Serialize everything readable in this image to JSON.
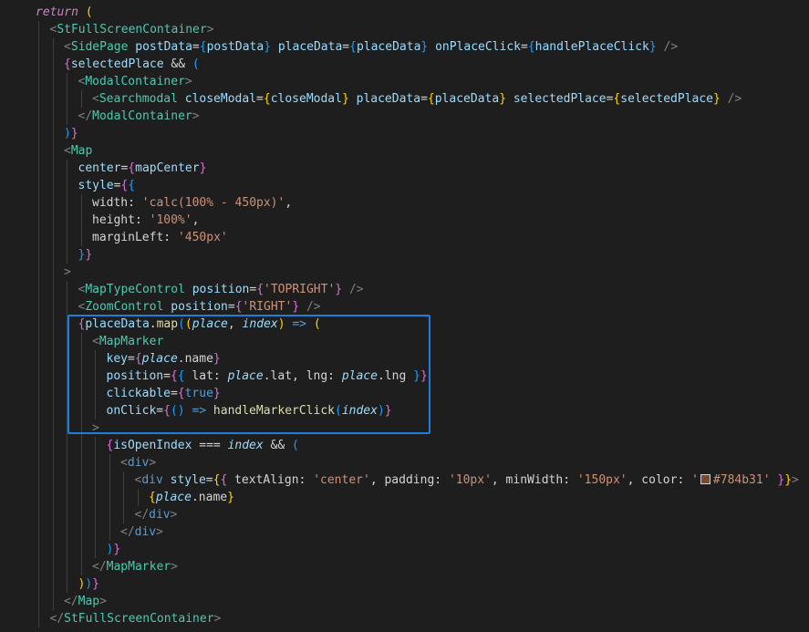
{
  "editor": {
    "swatch_color": "#784b31",
    "lines": [
      {
        "indent": 2,
        "tokens": [
          {
            "t": "return",
            "c": "kw"
          },
          {
            "t": " ",
            "c": "pl"
          },
          {
            "t": "(",
            "c": "b1"
          }
        ]
      },
      {
        "indent": 3,
        "tokens": [
          {
            "t": "<",
            "c": "pu"
          },
          {
            "t": "StFullScreenContainer",
            "c": "tg"
          },
          {
            "t": ">",
            "c": "pu"
          }
        ]
      },
      {
        "indent": 4,
        "tokens": [
          {
            "t": "<",
            "c": "pu"
          },
          {
            "t": "SidePage",
            "c": "tg"
          },
          {
            "t": " ",
            "c": "pl"
          },
          {
            "t": "postData",
            "c": "at"
          },
          {
            "t": "=",
            "c": "op"
          },
          {
            "t": "{",
            "c": "b3"
          },
          {
            "t": "postData",
            "c": "vr"
          },
          {
            "t": "}",
            "c": "b3"
          },
          {
            "t": " ",
            "c": "pl"
          },
          {
            "t": "placeData",
            "c": "at"
          },
          {
            "t": "=",
            "c": "op"
          },
          {
            "t": "{",
            "c": "b3"
          },
          {
            "t": "placeData",
            "c": "vr"
          },
          {
            "t": "}",
            "c": "b3"
          },
          {
            "t": " ",
            "c": "pl"
          },
          {
            "t": "onPlaceClick",
            "c": "at"
          },
          {
            "t": "=",
            "c": "op"
          },
          {
            "t": "{",
            "c": "b3"
          },
          {
            "t": "handlePlaceClick",
            "c": "vr"
          },
          {
            "t": "}",
            "c": "b3"
          },
          {
            "t": " />",
            "c": "pu"
          }
        ]
      },
      {
        "indent": 4,
        "tokens": [
          {
            "t": "{",
            "c": "b2"
          },
          {
            "t": "selectedPlace",
            "c": "vr"
          },
          {
            "t": " && ",
            "c": "op"
          },
          {
            "t": "(",
            "c": "b3"
          }
        ]
      },
      {
        "indent": 5,
        "tokens": [
          {
            "t": "<",
            "c": "pu"
          },
          {
            "t": "ModalContainer",
            "c": "tg"
          },
          {
            "t": ">",
            "c": "pu"
          }
        ]
      },
      {
        "indent": 6,
        "tokens": [
          {
            "t": "<",
            "c": "pu"
          },
          {
            "t": "Searchmodal",
            "c": "tg"
          },
          {
            "t": " ",
            "c": "pl"
          },
          {
            "t": "closeModal",
            "c": "at"
          },
          {
            "t": "=",
            "c": "op"
          },
          {
            "t": "{",
            "c": "b1"
          },
          {
            "t": "closeModal",
            "c": "vr"
          },
          {
            "t": "}",
            "c": "b1"
          },
          {
            "t": " ",
            "c": "pl"
          },
          {
            "t": "placeData",
            "c": "at"
          },
          {
            "t": "=",
            "c": "op"
          },
          {
            "t": "{",
            "c": "b1"
          },
          {
            "t": "placeData",
            "c": "vr"
          },
          {
            "t": "}",
            "c": "b1"
          },
          {
            "t": " ",
            "c": "pl"
          },
          {
            "t": "selectedPlace",
            "c": "at"
          },
          {
            "t": "=",
            "c": "op"
          },
          {
            "t": "{",
            "c": "b1"
          },
          {
            "t": "selectedPlace",
            "c": "vr"
          },
          {
            "t": "}",
            "c": "b1"
          },
          {
            "t": " />",
            "c": "pu"
          }
        ]
      },
      {
        "indent": 5,
        "tokens": [
          {
            "t": "</",
            "c": "pu"
          },
          {
            "t": "ModalContainer",
            "c": "tg"
          },
          {
            "t": ">",
            "c": "pu"
          }
        ]
      },
      {
        "indent": 4,
        "tokens": [
          {
            "t": ")",
            "c": "b3"
          },
          {
            "t": "}",
            "c": "b2"
          }
        ]
      },
      {
        "indent": 4,
        "tokens": [
          {
            "t": "<",
            "c": "pu"
          },
          {
            "t": "Map",
            "c": "tg"
          }
        ]
      },
      {
        "indent": 5,
        "tokens": [
          {
            "t": "center",
            "c": "at"
          },
          {
            "t": "=",
            "c": "op"
          },
          {
            "t": "{",
            "c": "b2"
          },
          {
            "t": "mapCenter",
            "c": "vr"
          },
          {
            "t": "}",
            "c": "b2"
          }
        ]
      },
      {
        "indent": 5,
        "tokens": [
          {
            "t": "style",
            "c": "at"
          },
          {
            "t": "=",
            "c": "op"
          },
          {
            "t": "{",
            "c": "b2"
          },
          {
            "t": "{",
            "c": "b3"
          }
        ]
      },
      {
        "indent": 6,
        "tokens": [
          {
            "t": "width",
            "c": "pl"
          },
          {
            "t": ": ",
            "c": "op"
          },
          {
            "t": "'calc(100% - 450px)'",
            "c": "st"
          },
          {
            "t": ",",
            "c": "op"
          }
        ]
      },
      {
        "indent": 6,
        "tokens": [
          {
            "t": "height",
            "c": "pl"
          },
          {
            "t": ": ",
            "c": "op"
          },
          {
            "t": "'100%'",
            "c": "st"
          },
          {
            "t": ",",
            "c": "op"
          }
        ]
      },
      {
        "indent": 6,
        "tokens": [
          {
            "t": "marginLeft",
            "c": "pl"
          },
          {
            "t": ": ",
            "c": "op"
          },
          {
            "t": "'450px'",
            "c": "st"
          }
        ]
      },
      {
        "indent": 5,
        "tokens": [
          {
            "t": "}",
            "c": "b3"
          },
          {
            "t": "}",
            "c": "b2"
          }
        ]
      },
      {
        "indent": 4,
        "tokens": [
          {
            "t": ">",
            "c": "pu"
          }
        ]
      },
      {
        "indent": 5,
        "tokens": [
          {
            "t": "<",
            "c": "pu"
          },
          {
            "t": "MapTypeControl",
            "c": "tg"
          },
          {
            "t": " ",
            "c": "pl"
          },
          {
            "t": "position",
            "c": "at"
          },
          {
            "t": "=",
            "c": "op"
          },
          {
            "t": "{",
            "c": "b2"
          },
          {
            "t": "'TOPRIGHT'",
            "c": "st"
          },
          {
            "t": "}",
            "c": "b2"
          },
          {
            "t": " />",
            "c": "pu"
          }
        ]
      },
      {
        "indent": 5,
        "tokens": [
          {
            "t": "<",
            "c": "pu"
          },
          {
            "t": "ZoomControl",
            "c": "tg"
          },
          {
            "t": " ",
            "c": "pl"
          },
          {
            "t": "position",
            "c": "at"
          },
          {
            "t": "=",
            "c": "op"
          },
          {
            "t": "{",
            "c": "b2"
          },
          {
            "t": "'RIGHT'",
            "c": "st"
          },
          {
            "t": "}",
            "c": "b2"
          },
          {
            "t": " />",
            "c": "pu"
          }
        ]
      },
      {
        "indent": 5,
        "tokens": [
          {
            "t": "{",
            "c": "b2"
          },
          {
            "t": "placeData",
            "c": "vr"
          },
          {
            "t": ".",
            "c": "op"
          },
          {
            "t": "map",
            "c": "fn"
          },
          {
            "t": "(",
            "c": "b3"
          },
          {
            "t": "(",
            "c": "b1"
          },
          {
            "t": "place",
            "c": "pa"
          },
          {
            "t": ", ",
            "c": "op"
          },
          {
            "t": "index",
            "c": "pa"
          },
          {
            "t": ")",
            "c": "b1"
          },
          {
            "t": " ",
            "c": "pl"
          },
          {
            "t": "=>",
            "c": "ar"
          },
          {
            "t": " ",
            "c": "pl"
          },
          {
            "t": "(",
            "c": "b1"
          }
        ]
      },
      {
        "indent": 6,
        "tokens": [
          {
            "t": "<",
            "c": "pu"
          },
          {
            "t": "MapMarker",
            "c": "tg"
          }
        ]
      },
      {
        "indent": 7,
        "tokens": [
          {
            "t": "key",
            "c": "at"
          },
          {
            "t": "=",
            "c": "op"
          },
          {
            "t": "{",
            "c": "b2"
          },
          {
            "t": "place",
            "c": "pa"
          },
          {
            "t": ".name",
            "c": "pl"
          },
          {
            "t": "}",
            "c": "b2"
          }
        ]
      },
      {
        "indent": 7,
        "tokens": [
          {
            "t": "position",
            "c": "at"
          },
          {
            "t": "=",
            "c": "op"
          },
          {
            "t": "{",
            "c": "b2"
          },
          {
            "t": "{",
            "c": "b3"
          },
          {
            "t": " lat",
            "c": "pl"
          },
          {
            "t": ": ",
            "c": "op"
          },
          {
            "t": "place",
            "c": "pa"
          },
          {
            "t": ".lat, ",
            "c": "pl"
          },
          {
            "t": "lng",
            "c": "pl"
          },
          {
            "t": ": ",
            "c": "op"
          },
          {
            "t": "place",
            "c": "pa"
          },
          {
            "t": ".lng ",
            "c": "pl"
          },
          {
            "t": "}",
            "c": "b3"
          },
          {
            "t": "}",
            "c": "b2"
          }
        ]
      },
      {
        "indent": 7,
        "tokens": [
          {
            "t": "clickable",
            "c": "at"
          },
          {
            "t": "=",
            "c": "op"
          },
          {
            "t": "{",
            "c": "b2"
          },
          {
            "t": "true",
            "c": "bk"
          },
          {
            "t": "}",
            "c": "b2"
          }
        ]
      },
      {
        "indent": 7,
        "tokens": [
          {
            "t": "onClick",
            "c": "at"
          },
          {
            "t": "=",
            "c": "op"
          },
          {
            "t": "{",
            "c": "b2"
          },
          {
            "t": "()",
            "c": "b3"
          },
          {
            "t": " ",
            "c": "pl"
          },
          {
            "t": "=>",
            "c": "ar"
          },
          {
            "t": " ",
            "c": "pl"
          },
          {
            "t": "handleMarkerClick",
            "c": "fn"
          },
          {
            "t": "(",
            "c": "b3"
          },
          {
            "t": "index",
            "c": "pa"
          },
          {
            "t": ")",
            "c": "b3"
          },
          {
            "t": "}",
            "c": "b2"
          }
        ]
      },
      {
        "indent": 6,
        "tokens": [
          {
            "t": ">",
            "c": "pu"
          }
        ]
      },
      {
        "indent": 7,
        "tokens": [
          {
            "t": "{",
            "c": "b2"
          },
          {
            "t": "isOpenIndex",
            "c": "vr"
          },
          {
            "t": " === ",
            "c": "op"
          },
          {
            "t": "index",
            "c": "pa"
          },
          {
            "t": " && ",
            "c": "op"
          },
          {
            "t": "(",
            "c": "b3"
          }
        ]
      },
      {
        "indent": 8,
        "tokens": [
          {
            "t": "<",
            "c": "pu"
          },
          {
            "t": "div",
            "c": "bk"
          },
          {
            "t": ">",
            "c": "pu"
          }
        ]
      },
      {
        "indent": 9,
        "tokens": [
          {
            "t": "<",
            "c": "pu"
          },
          {
            "t": "div",
            "c": "bk"
          },
          {
            "t": " ",
            "c": "pl"
          },
          {
            "t": "style",
            "c": "at"
          },
          {
            "t": "=",
            "c": "op"
          },
          {
            "t": "{",
            "c": "b1"
          },
          {
            "t": "{",
            "c": "b2"
          },
          {
            "t": " textAlign",
            "c": "pl"
          },
          {
            "t": ": ",
            "c": "op"
          },
          {
            "t": "'center'",
            "c": "st"
          },
          {
            "t": ", padding",
            "c": "pl"
          },
          {
            "t": ": ",
            "c": "op"
          },
          {
            "t": "'10px'",
            "c": "st"
          },
          {
            "t": ", minWidth",
            "c": "pl"
          },
          {
            "t": ": ",
            "c": "op"
          },
          {
            "t": "'150px'",
            "c": "st"
          },
          {
            "t": ", color",
            "c": "pl"
          },
          {
            "t": ": ",
            "c": "op"
          },
          {
            "t": "'",
            "c": "st"
          },
          {
            "t": "",
            "c": "swatch"
          },
          {
            "t": "#784b31'",
            "c": "st"
          },
          {
            "t": " ",
            "c": "pl"
          },
          {
            "t": "}",
            "c": "b2"
          },
          {
            "t": "}",
            "c": "b1"
          },
          {
            "t": ">",
            "c": "pu"
          }
        ]
      },
      {
        "indent": 10,
        "tokens": [
          {
            "t": "{",
            "c": "b1"
          },
          {
            "t": "place",
            "c": "pa"
          },
          {
            "t": ".name",
            "c": "pl"
          },
          {
            "t": "}",
            "c": "b1"
          }
        ]
      },
      {
        "indent": 9,
        "tokens": [
          {
            "t": "</",
            "c": "pu"
          },
          {
            "t": "div",
            "c": "bk"
          },
          {
            "t": ">",
            "c": "pu"
          }
        ]
      },
      {
        "indent": 8,
        "tokens": [
          {
            "t": "</",
            "c": "pu"
          },
          {
            "t": "div",
            "c": "bk"
          },
          {
            "t": ">",
            "c": "pu"
          }
        ]
      },
      {
        "indent": 7,
        "tokens": [
          {
            "t": ")",
            "c": "b3"
          },
          {
            "t": "}",
            "c": "b2"
          }
        ]
      },
      {
        "indent": 6,
        "tokens": [
          {
            "t": "</",
            "c": "pu"
          },
          {
            "t": "MapMarker",
            "c": "tg"
          },
          {
            "t": ">",
            "c": "pu"
          }
        ]
      },
      {
        "indent": 5,
        "tokens": [
          {
            "t": ")",
            "c": "b1"
          },
          {
            "t": ")",
            "c": "b3"
          },
          {
            "t": "}",
            "c": "b2"
          }
        ]
      },
      {
        "indent": 4,
        "tokens": [
          {
            "t": "</",
            "c": "pu"
          },
          {
            "t": "Map",
            "c": "tg"
          },
          {
            "t": ">",
            "c": "pu"
          }
        ]
      },
      {
        "indent": 3,
        "tokens": [
          {
            "t": "</",
            "c": "pu"
          },
          {
            "t": "StFullScreenContainer",
            "c": "tg"
          },
          {
            "t": ">",
            "c": "pu"
          }
        ]
      }
    ]
  }
}
